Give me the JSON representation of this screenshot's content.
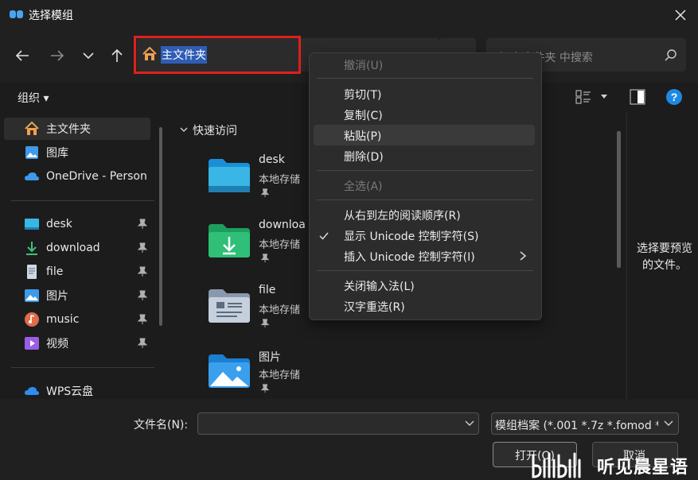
{
  "window": {
    "title": "选择模组",
    "close_icon": "close-icon"
  },
  "nav": {
    "back_icon": "arrow-left-icon",
    "forward_icon": "arrow-right-icon",
    "recent_icon": "chevron-down-icon",
    "up_icon": "arrow-up-icon",
    "address_text": "主文件夹",
    "search_placeholder": "在 主文件夹 中搜索"
  },
  "toolbar": {
    "organize_label": "组织 ▾"
  },
  "sidebar": {
    "items": [
      {
        "label": "主文件夹",
        "icon": "home-icon"
      },
      {
        "label": "图库",
        "icon": "gallery-icon"
      },
      {
        "label": "OneDrive - Person",
        "icon": "cloud-icon"
      },
      {
        "label": "desk",
        "icon": "desktop-icon",
        "pinned": true
      },
      {
        "label": "download",
        "icon": "download-icon",
        "pinned": true
      },
      {
        "label": "file",
        "icon": "document-icon",
        "pinned": true
      },
      {
        "label": "图片",
        "icon": "pictures-icon",
        "pinned": true
      },
      {
        "label": "music",
        "icon": "music-icon",
        "pinned": true
      },
      {
        "label": "视频",
        "icon": "video-icon",
        "pinned": true
      },
      {
        "label": "WPS云盘",
        "icon": "wps-cloud-icon"
      }
    ]
  },
  "content": {
    "section_title": "快速访问",
    "tiles": [
      {
        "name": "desk",
        "sub": "本地存储",
        "icon": "desktop-folder-icon"
      },
      {
        "name": "downloa",
        "sub": "本地存储",
        "icon": "download-folder-icon"
      },
      {
        "name": "file",
        "sub": "本地存储",
        "icon": "document-folder-icon"
      },
      {
        "name": "图片",
        "sub": "本地存储",
        "icon": "pictures-folder-icon"
      }
    ]
  },
  "preview": {
    "text_line1": "选择要预览",
    "text_line2": "的文件。"
  },
  "context_menu": {
    "undo": "撤消(U)",
    "cut": "剪切(T)",
    "copy": "复制(C)",
    "paste": "粘贴(P)",
    "delete": "删除(D)",
    "select_all": "全选(A)",
    "rtl": "从右到左的阅读顺序(R)",
    "show_unicode": "显示 Unicode 控制字符(S)",
    "insert_unicode": "插入 Unicode 控制字符(I)",
    "close_ime": "关闭输入法(L)",
    "reconvert": "汉字重选(R)"
  },
  "bottom": {
    "filename_label": "文件名(N):",
    "filename_value": "",
    "filetype": "模组档案 (*.001 *.7z *.fomod *",
    "open_label": "打开(O)",
    "cancel_label": "取消"
  },
  "watermark": {
    "text": "听见晨星语"
  },
  "colors": {
    "accent": "#2f5db5",
    "highlight_box": "#e0201c",
    "help": "#1e88e5"
  }
}
